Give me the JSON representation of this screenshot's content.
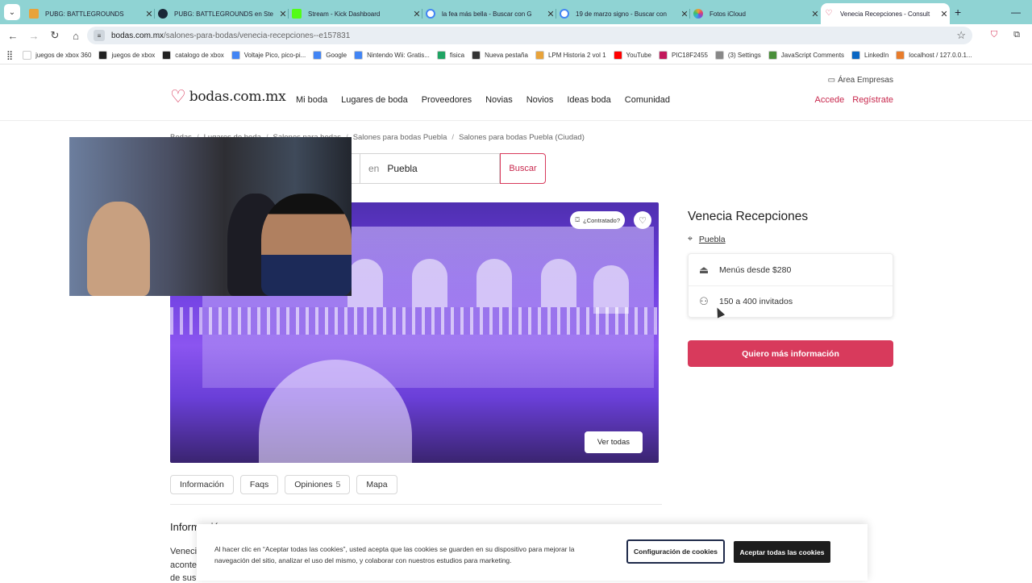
{
  "browser": {
    "tabs": [
      {
        "title": "PUBG: BATTLEGROUNDS",
        "color": "#e8a33a"
      },
      {
        "title": "PUBG: BATTLEGROUNDS en Ste",
        "color": "#1b2838"
      },
      {
        "title": "Stream - Kick Dashboard",
        "color": "#53fc18"
      },
      {
        "title": "la fea más bella - Buscar con G",
        "color": "#4285f4"
      },
      {
        "title": "19 de marzo signo - Buscar con",
        "color": "#4285f4"
      },
      {
        "title": "Fotos iCloud",
        "color": "#f0a030"
      },
      {
        "title": "Venecia Recepciones - Consult",
        "color": "#d83a5c"
      }
    ],
    "url_host": "bodas.com.mx",
    "url_path": "/salones-para-bodas/venecia-recepciones--e157831",
    "bookmarks": [
      {
        "label": "juegos de xbox 360",
        "color": "#ffffff"
      },
      {
        "label": "juegos de xbox",
        "color": "#222222"
      },
      {
        "label": "catalogo de xbox",
        "color": "#222222"
      },
      {
        "label": "Voltaje Pico, pico-pi...",
        "color": "#4285f4"
      },
      {
        "label": "Google",
        "color": "#4285f4"
      },
      {
        "label": "Nintendo Wii: Gratis...",
        "color": "#4285f4"
      },
      {
        "label": "fisica",
        "color": "#1fa463"
      },
      {
        "label": "Nueva pestaña",
        "color": "#333333"
      },
      {
        "label": "LPM Historia 2 vol 1",
        "color": "#e8a33a"
      },
      {
        "label": "YouTube",
        "color": "#ff0000"
      },
      {
        "label": "PIC18F2455",
        "color": "#c2185b"
      },
      {
        "label": "(3) Settings",
        "color": "#888888"
      },
      {
        "label": "JavaScript Comments",
        "color": "#4a8f3a"
      },
      {
        "label": "LinkedIn",
        "color": "#0a66c2"
      },
      {
        "label": "localhost / 127.0.0.1...",
        "color": "#e87c2b"
      }
    ]
  },
  "site": {
    "logo_text": "bodas.com.mx",
    "nav": [
      "Mi boda",
      "Lugares de boda",
      "Proveedores",
      "Novias",
      "Novios",
      "Ideas boda",
      "Comunidad"
    ],
    "area_empresas": "Área Empresas",
    "login": "Accede",
    "register": "Regístrate",
    "breadcrumb": [
      "Bodas",
      "Lugares de boda",
      "Salones para bodas",
      "Salones para bodas Puebla",
      "Salones para bodas Puebla (Ciudad)"
    ],
    "search": {
      "prefix": "en",
      "location": "Puebla",
      "button": "Buscar"
    },
    "gallery": {
      "hired_badge": "¿Contratado?",
      "view_all": "Ver todas"
    },
    "tabs": [
      {
        "label": "Información",
        "count": ""
      },
      {
        "label": "Faqs",
        "count": ""
      },
      {
        "label": "Opiniones",
        "count": "5"
      },
      {
        "label": "Mapa",
        "count": ""
      }
    ],
    "info_heading": "Información",
    "info_lines": [
      "Venecia",
      "aconte",
      "de sus"
    ],
    "venue": {
      "name": "Venecia Recepciones",
      "location": "Puebla",
      "menu": "Menús desde $280",
      "guests": "150 a 400 invitados",
      "cta": "Quiero más información"
    },
    "cookies": {
      "text": "Al hacer clic en “Aceptar todas las cookies”, usted acepta que las cookies se guarden en su dispositivo para mejorar la navegación del sitio, analizar el uso del mismo, y colaborar con nuestros estudios para marketing.",
      "config": "Configuración de cookies",
      "accept": "Aceptar todas las cookies"
    },
    "accent_color": "#d83a5c"
  }
}
